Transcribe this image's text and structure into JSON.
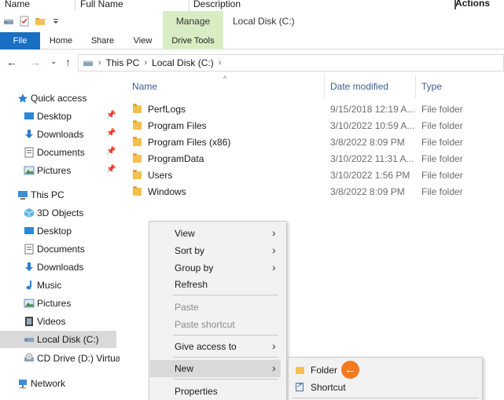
{
  "bg_header": {
    "col1": "Name",
    "col2": "Full Name",
    "col3": "Description",
    "actions": "Actions"
  },
  "title": {
    "manage_label": "Manage",
    "window_title": "Local Disk (C:)"
  },
  "ribbon": {
    "tabs": [
      "File",
      "Home",
      "Share",
      "View",
      "Drive Tools"
    ]
  },
  "address": {
    "crumbs": [
      "This PC",
      "Local Disk (C:)"
    ]
  },
  "nav": {
    "quick_access": "Quick access",
    "quick_items": [
      "Desktop",
      "Downloads",
      "Documents",
      "Pictures"
    ],
    "this_pc": "This PC",
    "pc_items": [
      "3D Objects",
      "Desktop",
      "Documents",
      "Downloads",
      "Music",
      "Pictures",
      "Videos",
      "Local Disk (C:)",
      "CD Drive (D:) Virtua"
    ],
    "network": "Network"
  },
  "columns": {
    "name": "Name",
    "date": "Date modified",
    "type": "Type"
  },
  "files": [
    {
      "name": "PerfLogs",
      "date": "9/15/2018 12:19 A...",
      "type": "File folder"
    },
    {
      "name": "Program Files",
      "date": "3/10/2022 10:59 A...",
      "type": "File folder"
    },
    {
      "name": "Program Files (x86)",
      "date": "3/8/2022 8:09 PM",
      "type": "File folder"
    },
    {
      "name": "ProgramData",
      "date": "3/10/2022 11:31 A...",
      "type": "File folder"
    },
    {
      "name": "Users",
      "date": "3/10/2022 1:56 PM",
      "type": "File folder"
    },
    {
      "name": "Windows",
      "date": "3/8/2022 8:09 PM",
      "type": "File folder"
    }
  ],
  "context_menu": {
    "view": "View",
    "sort_by": "Sort by",
    "group_by": "Group by",
    "refresh": "Refresh",
    "paste": "Paste",
    "paste_shortcut": "Paste shortcut",
    "give_access": "Give access to",
    "new": "New",
    "properties": "Properties"
  },
  "submenu": {
    "folder": "Folder",
    "shortcut": "Shortcut"
  },
  "colors": {
    "accent": "#1a6fc2",
    "manage": "#d9edc4",
    "callout": "#f47a20"
  }
}
